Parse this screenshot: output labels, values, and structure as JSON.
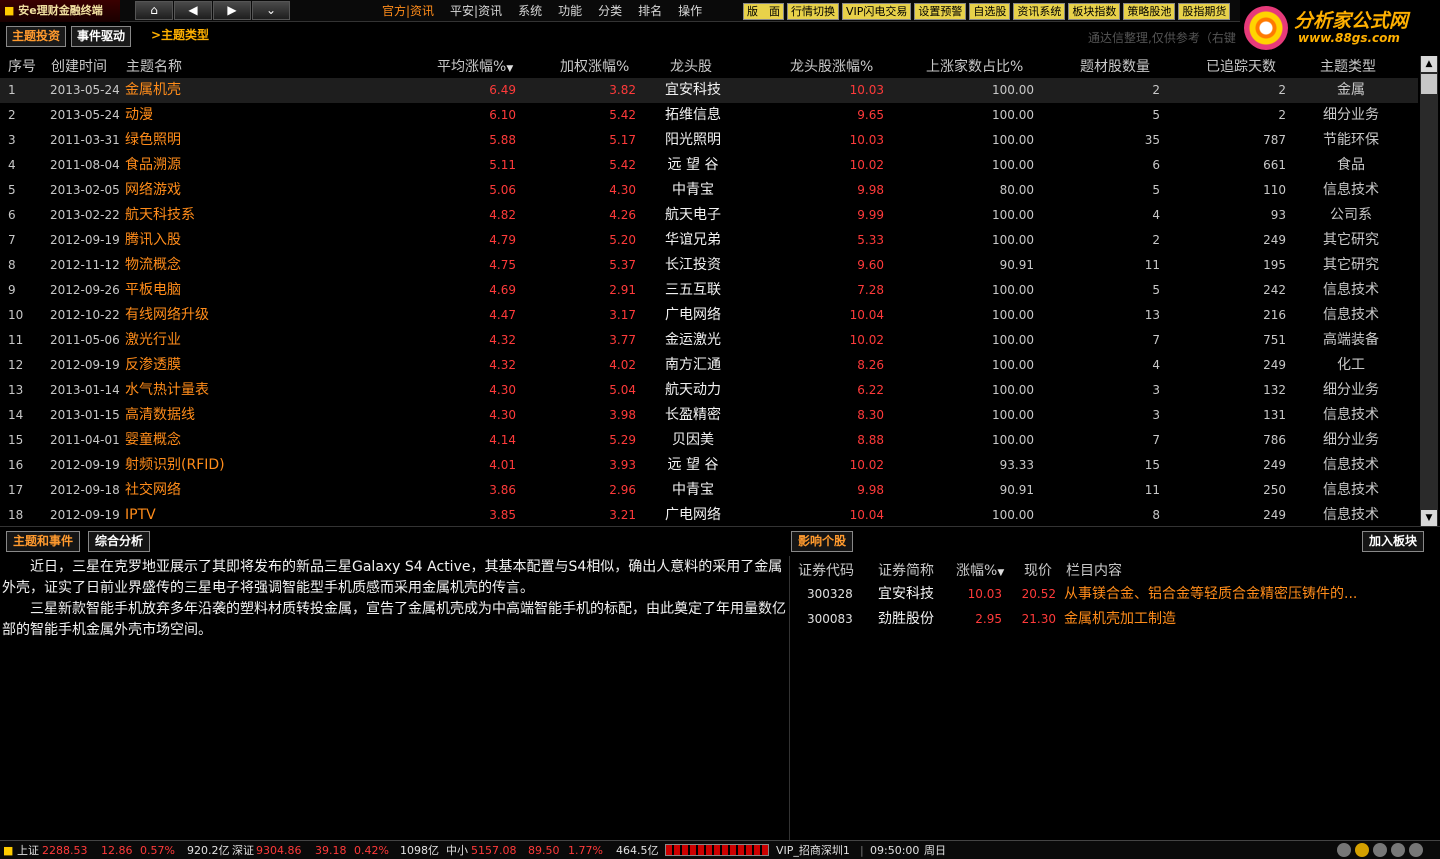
{
  "topbar": {
    "app_title": "安e理财金融终端",
    "nav": {
      "home": "⌂",
      "back": "◀",
      "forward": "▶",
      "expand": "⌄"
    },
    "menu": [
      "官方|资讯",
      "平安|资讯",
      "系统",
      "功能",
      "分类",
      "排名",
      "操作"
    ],
    "quick": [
      "版　面",
      "行情切换",
      "VIP闪电交易",
      "设置预警",
      "自选股",
      "资讯系统",
      "板块指数",
      "策略股池",
      "股指期货"
    ]
  },
  "brand": {
    "name": "分析家公式网",
    "url": "www.88gs.com"
  },
  "tabs": {
    "t1": "主题投资",
    "t2": "事件驱动",
    "t3": ">主题类型"
  },
  "tip": "通达信整理,仅供参考（右键",
  "table": {
    "headers": {
      "idx": "序号",
      "date": "创建时间",
      "name": "主题名称",
      "avg": "平均涨幅%",
      "wt": "加权涨幅%",
      "lead": "龙头股",
      "leadp": "龙头股涨幅%",
      "up": "上涨家数占比%",
      "cnt": "题材股数量",
      "days": "已追踪天数",
      "type": "主题类型"
    },
    "rows": [
      {
        "idx": "1",
        "date": "2013-05-24",
        "name": "金属机壳",
        "avg": "6.49",
        "wt": "3.82",
        "lead": "宜安科技",
        "leadp": "10.03",
        "up": "100.00",
        "cnt": "2",
        "days": "2",
        "type": "金属"
      },
      {
        "idx": "2",
        "date": "2013-05-24",
        "name": "动漫",
        "avg": "6.10",
        "wt": "5.42",
        "lead": "拓维信息",
        "leadp": "9.65",
        "up": "100.00",
        "cnt": "5",
        "days": "2",
        "type": "细分业务"
      },
      {
        "idx": "3",
        "date": "2011-03-31",
        "name": "绿色照明",
        "avg": "5.88",
        "wt": "5.17",
        "lead": "阳光照明",
        "leadp": "10.03",
        "up": "100.00",
        "cnt": "35",
        "days": "787",
        "type": "节能环保"
      },
      {
        "idx": "4",
        "date": "2011-08-04",
        "name": "食品溯源",
        "avg": "5.11",
        "wt": "5.42",
        "lead": "远 望 谷",
        "leadp": "10.02",
        "up": "100.00",
        "cnt": "6",
        "days": "661",
        "type": "食品"
      },
      {
        "idx": "5",
        "date": "2013-02-05",
        "name": "网络游戏",
        "avg": "5.06",
        "wt": "4.30",
        "lead": "中青宝",
        "leadp": "9.98",
        "up": "80.00",
        "cnt": "5",
        "days": "110",
        "type": "信息技术"
      },
      {
        "idx": "6",
        "date": "2013-02-22",
        "name": "航天科技系",
        "avg": "4.82",
        "wt": "4.26",
        "lead": "航天电子",
        "leadp": "9.99",
        "up": "100.00",
        "cnt": "4",
        "days": "93",
        "type": "公司系"
      },
      {
        "idx": "7",
        "date": "2012-09-19",
        "name": "腾讯入股",
        "avg": "4.79",
        "wt": "5.20",
        "lead": "华谊兄弟",
        "leadp": "5.33",
        "up": "100.00",
        "cnt": "2",
        "days": "249",
        "type": "其它研究"
      },
      {
        "idx": "8",
        "date": "2012-11-12",
        "name": "物流概念",
        "avg": "4.75",
        "wt": "5.37",
        "lead": "长江投资",
        "leadp": "9.60",
        "up": "90.91",
        "cnt": "11",
        "days": "195",
        "type": "其它研究"
      },
      {
        "idx": "9",
        "date": "2012-09-26",
        "name": "平板电脑",
        "avg": "4.69",
        "wt": "2.91",
        "lead": "三五互联",
        "leadp": "7.28",
        "up": "100.00",
        "cnt": "5",
        "days": "242",
        "type": "信息技术"
      },
      {
        "idx": "10",
        "date": "2012-10-22",
        "name": "有线网络升级",
        "avg": "4.47",
        "wt": "3.17",
        "lead": "广电网络",
        "leadp": "10.04",
        "up": "100.00",
        "cnt": "13",
        "days": "216",
        "type": "信息技术"
      },
      {
        "idx": "11",
        "date": "2011-05-06",
        "name": "激光行业",
        "avg": "4.32",
        "wt": "3.77",
        "lead": "金运激光",
        "leadp": "10.02",
        "up": "100.00",
        "cnt": "7",
        "days": "751",
        "type": "高端装备"
      },
      {
        "idx": "12",
        "date": "2012-09-19",
        "name": "反渗透膜",
        "avg": "4.32",
        "wt": "4.02",
        "lead": "南方汇通",
        "leadp": "8.26",
        "up": "100.00",
        "cnt": "4",
        "days": "249",
        "type": "化工"
      },
      {
        "idx": "13",
        "date": "2013-01-14",
        "name": "水气热计量表",
        "avg": "4.30",
        "wt": "5.04",
        "lead": "航天动力",
        "leadp": "6.22",
        "up": "100.00",
        "cnt": "3",
        "days": "132",
        "type": "细分业务"
      },
      {
        "idx": "14",
        "date": "2013-01-15",
        "name": "高清数据线",
        "avg": "4.30",
        "wt": "3.98",
        "lead": "长盈精密",
        "leadp": "8.30",
        "up": "100.00",
        "cnt": "3",
        "days": "131",
        "type": "信息技术"
      },
      {
        "idx": "15",
        "date": "2011-04-01",
        "name": "婴童概念",
        "avg": "4.14",
        "wt": "5.29",
        "lead": "贝因美",
        "leadp": "8.88",
        "up": "100.00",
        "cnt": "7",
        "days": "786",
        "type": "细分业务"
      },
      {
        "idx": "16",
        "date": "2012-09-19",
        "name": "射频识别(RFID)",
        "avg": "4.01",
        "wt": "3.93",
        "lead": "远 望 谷",
        "leadp": "10.02",
        "up": "93.33",
        "cnt": "15",
        "days": "249",
        "type": "信息技术"
      },
      {
        "idx": "17",
        "date": "2012-09-18",
        "name": "社交网络",
        "avg": "3.86",
        "wt": "2.96",
        "lead": "中青宝",
        "leadp": "9.98",
        "up": "90.91",
        "cnt": "11",
        "days": "250",
        "type": "信息技术"
      },
      {
        "idx": "18",
        "date": "2012-09-19",
        "name": "IPTV",
        "avg": "3.85",
        "wt": "3.21",
        "lead": "广电网络",
        "leadp": "10.04",
        "up": "100.00",
        "cnt": "8",
        "days": "249",
        "type": "信息技术"
      }
    ]
  },
  "bottom_tabs": {
    "b1": "主题和事件",
    "b2": "综合分析",
    "b3": "影响个股",
    "b4": "加入板块"
  },
  "news": [
    "近日，三星在克罗地亚展示了其即将发布的新品三星Galaxy S4 Active，其基本配置与S4相似，确出人意料的采用了金属外壳，证实了日前业界盛传的三星电子将强调智能型手机质感而采用金属机壳的传言。",
    "三星新款智能手机放弃多年沿袭的塑料材质转投金属，宣告了金属机壳成为中高端智能手机的标配，由此奠定了年用量数亿部的智能手机金属外壳市场空间。"
  ],
  "stocks": {
    "headers": {
      "code": "证券代码",
      "abbr": "证券简称",
      "chg": "涨幅%",
      "price": "现价",
      "content": "栏目内容"
    },
    "rows": [
      {
        "code": "300328",
        "abbr": "宜安科技",
        "chg": "10.03",
        "price": "20.52",
        "content": "从事镁合金、铝合金等轻质合金精密压铸件的..."
      },
      {
        "code": "300083",
        "abbr": "劲胜股份",
        "chg": "2.95",
        "price": "21.30",
        "content": "金属机壳加工制造"
      }
    ]
  },
  "status": {
    "sh_label": "上证",
    "sh_val": "2288.53",
    "sh_chg": "12.86",
    "sh_pct": "0.57%",
    "sh_amt": "920.2亿",
    "sz_label": "深证",
    "sz_val": "9304.86",
    "sz_chg": "39.18",
    "sz_pct": "0.42%",
    "sz_amt": "1098亿",
    "zx_label": "中小",
    "zx_val": "5157.08",
    "zx_chg": "89.50",
    "zx_pct": "1.77%",
    "zx_amt": "464.5亿",
    "server": "VIP_招商深圳1",
    "time": "09:50:00",
    "weekday": "周日"
  }
}
